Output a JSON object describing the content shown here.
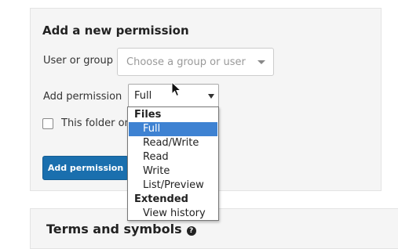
{
  "panel": {
    "title": "Add a new permission",
    "user_label": "User or group",
    "user_placeholder": "Choose a group or user",
    "perm_label": "Add permission",
    "perm_value": "Full",
    "folder_only_label_visible": "This folder on",
    "folder_only_label_tail": ")",
    "add_button": "Add permission"
  },
  "dropdown": {
    "group_files": "Files",
    "files_options": [
      "Full",
      "Read/Write",
      "Read",
      "Write",
      "List/Preview"
    ],
    "group_extended": "Extended",
    "extended_options": [
      "View history"
    ],
    "selected": "Full"
  },
  "terms": {
    "title": "Terms and symbols",
    "help_glyph": "?"
  },
  "colors": {
    "primary_button": "#1a6fae",
    "selected_option": "#3e82d2"
  }
}
